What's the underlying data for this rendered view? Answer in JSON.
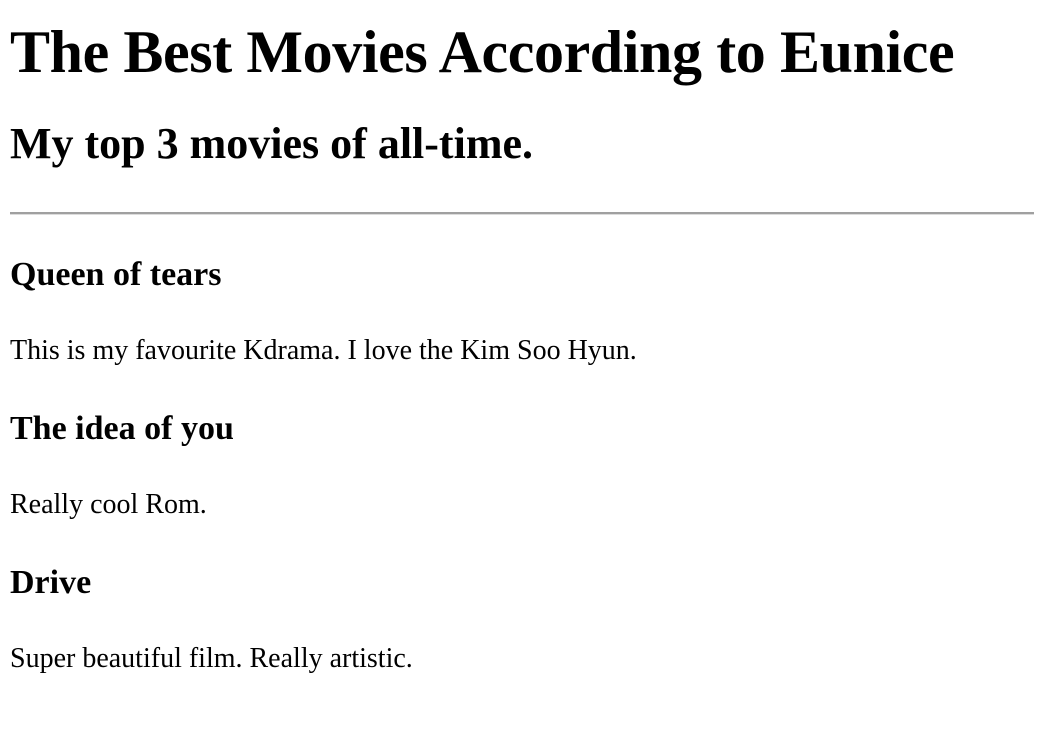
{
  "page": {
    "title": "The Best Movies According to Eunice",
    "subtitle": "My top 3 movies of all-time."
  },
  "movies": [
    {
      "title": "Queen of tears",
      "description": "This is my favourite Kdrama. I love the Kim Soo Hyun."
    },
    {
      "title": "The idea of you",
      "description": "Really cool Rom."
    },
    {
      "title": "Drive",
      "description": "Super beautiful film. Really artistic."
    }
  ]
}
